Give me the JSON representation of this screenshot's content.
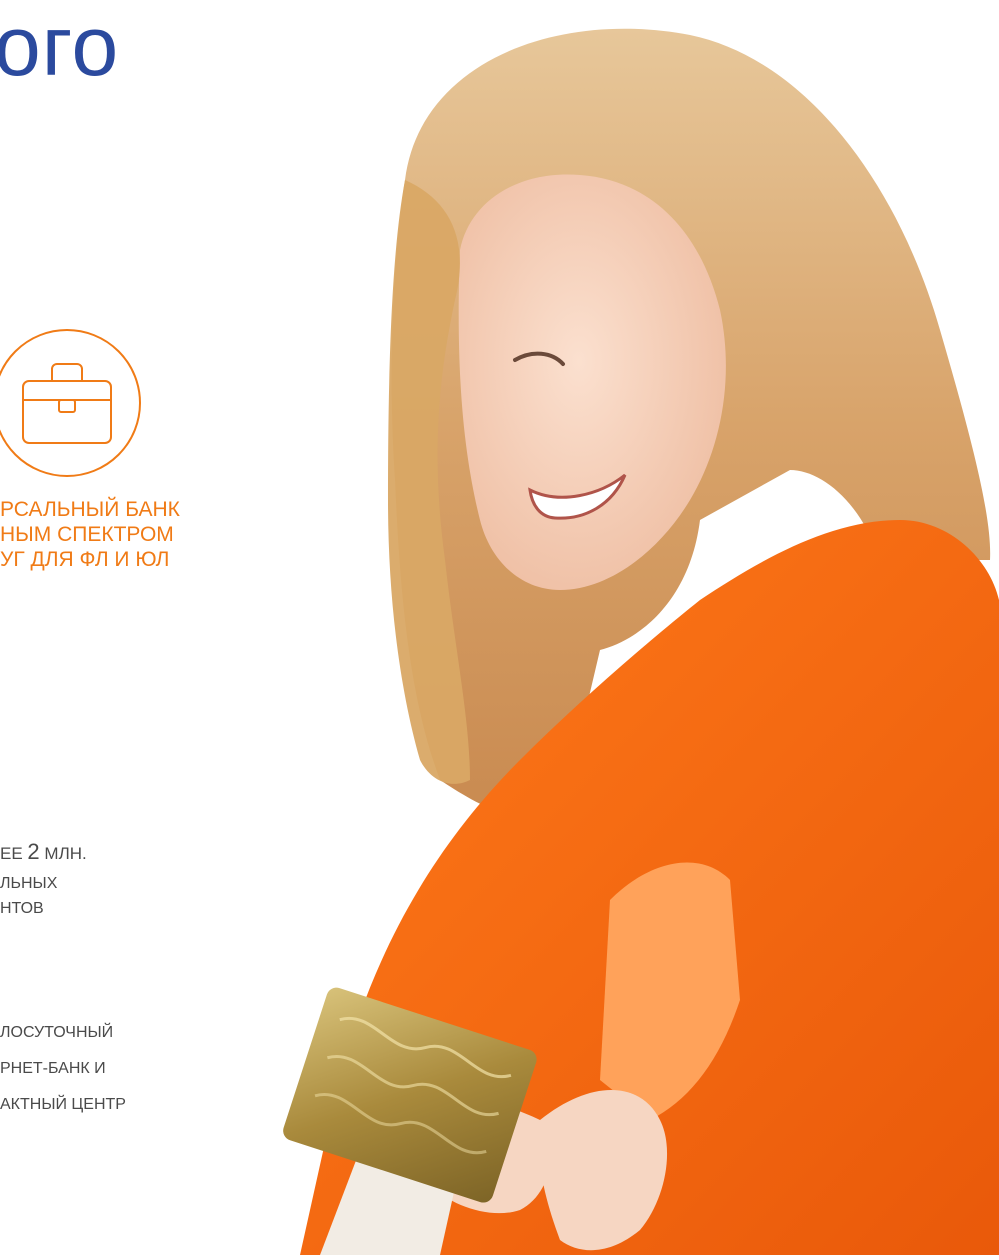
{
  "headline": "ого",
  "feature": {
    "icon": "briefcase-icon",
    "caption_lines": [
      "рсальный банк",
      "ным спектром",
      "уг для ФЛ и ЮЛ"
    ]
  },
  "stats": [
    {
      "lines": [
        "ее",
        "2",
        "млн.",
        "льных",
        "нтов"
      ]
    },
    {
      "lines": [
        "лосуточный",
        "рнет-банк и",
        "актный центр"
      ]
    }
  ],
  "photo": {
    "icon": "woman-with-card-photo"
  },
  "colors": {
    "brand_blue": "#2b4a9e",
    "accent_orange": "#f07b16",
    "text_gray": "#4a4a4a"
  }
}
